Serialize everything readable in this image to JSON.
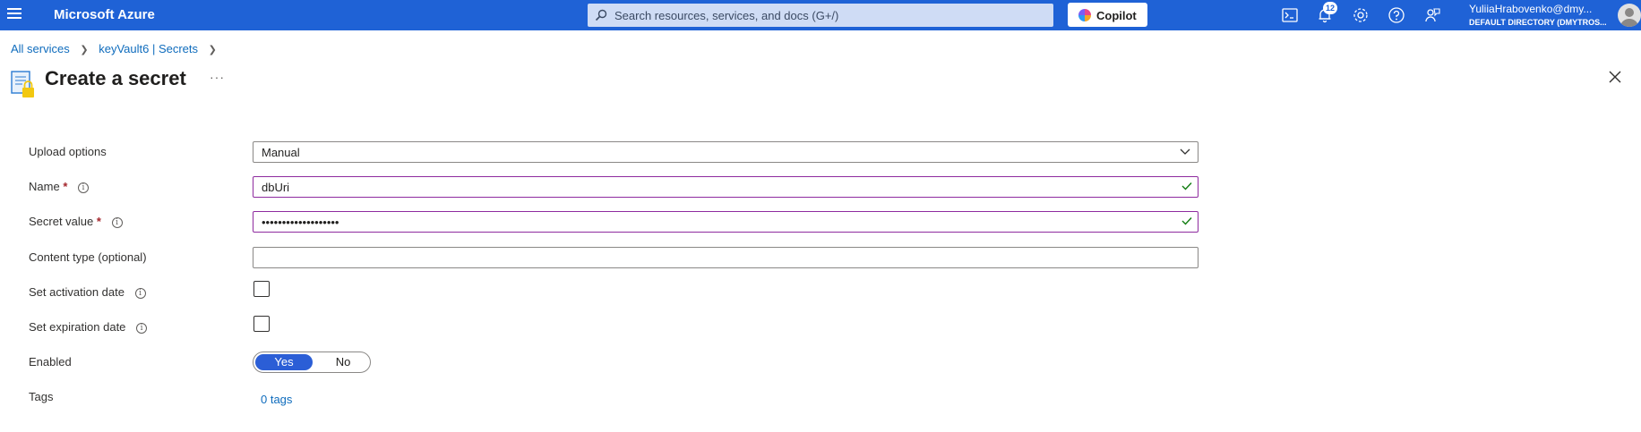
{
  "topbar": {
    "brand": "Microsoft Azure",
    "search_placeholder": "Search resources, services, and docs (G+/)",
    "copilot_label": "Copilot",
    "notification_count": "12",
    "user_name": "YuliiaHrabovenko@dmy...",
    "user_directory": "DEFAULT DIRECTORY (DMYTROS..."
  },
  "breadcrumb": {
    "items": [
      "All services",
      "keyVault6 | Secrets"
    ]
  },
  "page": {
    "title": "Create a secret",
    "more": "···"
  },
  "form": {
    "upload_options": {
      "label": "Upload options",
      "value": "Manual"
    },
    "name": {
      "label": "Name",
      "required": "*",
      "value": "dbUri"
    },
    "secret_value": {
      "label": "Secret value",
      "required": "*",
      "value": "•••••••••••••••••••"
    },
    "content_type": {
      "label": "Content type (optional)",
      "value": ""
    },
    "activation_date": {
      "label": "Set activation date"
    },
    "expiration_date": {
      "label": "Set expiration date"
    },
    "enabled": {
      "label": "Enabled",
      "yes": "Yes",
      "no": "No",
      "selected": "Yes"
    },
    "tags": {
      "label": "Tags",
      "link": "0 tags"
    }
  },
  "colors": {
    "topbar": "#1f62d6",
    "link": "#0f6cbd",
    "valid_border": "#8e2b9f",
    "valid_check": "#107c10",
    "toggle_selected": "#2b5ed6"
  }
}
